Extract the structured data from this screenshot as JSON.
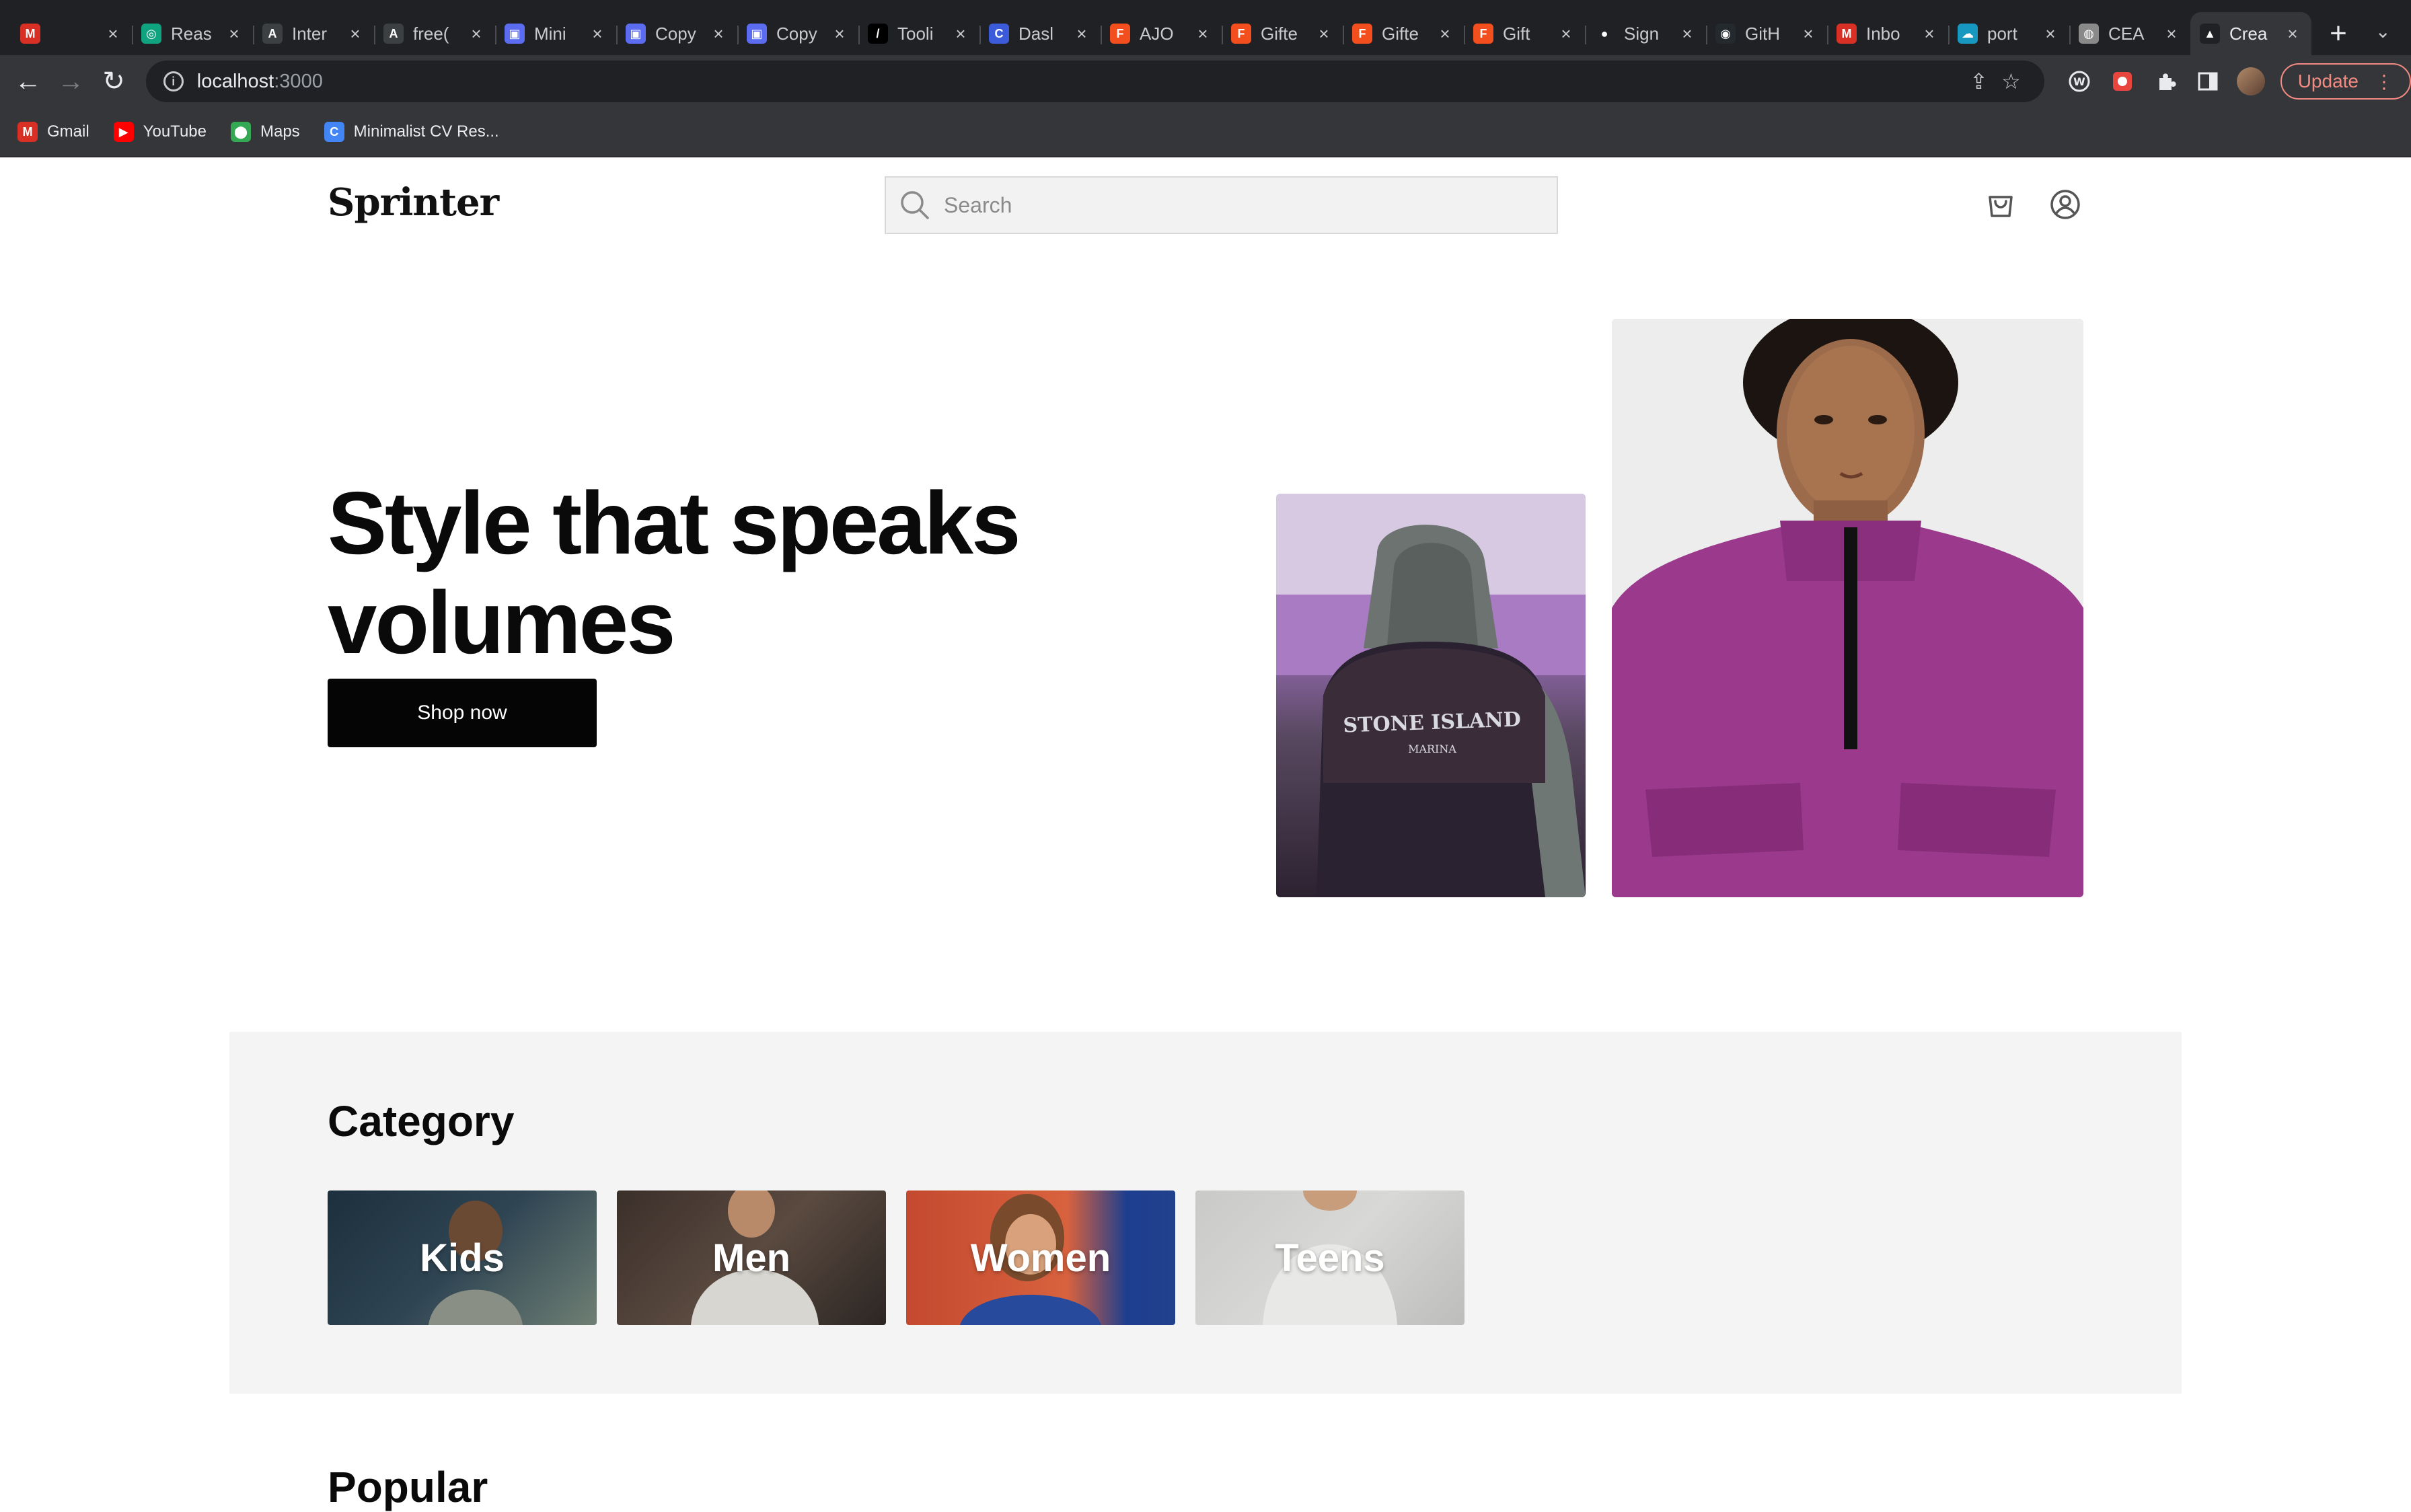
{
  "browser": {
    "tabs": [
      {
        "title": "",
        "favicon": "gmail-m-icon",
        "color": "#d93025",
        "glyph": "M"
      },
      {
        "title": "Reas",
        "favicon": "openai-icon",
        "color": "#10a37f",
        "glyph": "◎"
      },
      {
        "title": "Inter",
        "favicon": "angular-a-icon",
        "color": "#3c4043",
        "glyph": "A"
      },
      {
        "title": "free(",
        "favicon": "angular-a-icon",
        "color": "#3c4043",
        "glyph": "A"
      },
      {
        "title": "Mini",
        "favicon": "app-icon",
        "color": "#5b6cf0",
        "glyph": "▣"
      },
      {
        "title": "Copy",
        "favicon": "app-icon",
        "color": "#5b6cf0",
        "glyph": "▣"
      },
      {
        "title": "Copy",
        "favicon": "app-icon",
        "color": "#5b6cf0",
        "glyph": "▣"
      },
      {
        "title": "Tooli",
        "favicon": "slash-icon",
        "color": "#000000",
        "glyph": "/"
      },
      {
        "title": "Dasl",
        "favicon": "c-logo-icon",
        "color": "#3b5bdb",
        "glyph": "C"
      },
      {
        "title": "AJO",
        "favicon": "figma-icon",
        "color": "#f24e1e",
        "glyph": "F"
      },
      {
        "title": "Gifte",
        "favicon": "figma-icon",
        "color": "#f24e1e",
        "glyph": "F"
      },
      {
        "title": "Gifte",
        "favicon": "figma-icon",
        "color": "#f24e1e",
        "glyph": "F"
      },
      {
        "title": "Gift",
        "favicon": "figma-icon",
        "color": "#f24e1e",
        "glyph": "F"
      },
      {
        "title": "Sign",
        "favicon": "dot-icon",
        "color": "#202124",
        "glyph": "●"
      },
      {
        "title": "GitH",
        "favicon": "github-icon",
        "color": "#24292e",
        "glyph": "◉"
      },
      {
        "title": "Inbo",
        "favicon": "gmail-m-icon",
        "color": "#d93025",
        "glyph": "M"
      },
      {
        "title": "port",
        "favicon": "salesforce-cloud-icon",
        "color": "#1798c1",
        "glyph": "☁"
      },
      {
        "title": "CEA",
        "favicon": "seal-icon",
        "color": "#8a8a8a",
        "glyph": "◍"
      },
      {
        "title": "Crea",
        "favicon": "triangle-icon",
        "color": "#202124",
        "glyph": "▲",
        "active": true
      }
    ],
    "new_tab_glyph": "+",
    "tab_menu_glyph": "⌄",
    "url_host": "localhost",
    "url_port": ":3000",
    "update_label": "Update",
    "update_menu_glyph": "⋮",
    "bookmarks": [
      {
        "label": "Gmail",
        "icon": "gmail-icon",
        "color": "#d93025",
        "glyph": "M"
      },
      {
        "label": "YouTube",
        "icon": "youtube-icon",
        "color": "#ff0000",
        "glyph": "▶"
      },
      {
        "label": "Maps",
        "icon": "maps-pin-icon",
        "color": "#34a853",
        "glyph": "⬤"
      },
      {
        "label": "Minimalist CV Res...",
        "icon": "cv-icon",
        "color": "#4285f4",
        "glyph": "C"
      }
    ]
  },
  "site": {
    "logo": "Sprinter",
    "search_placeholder": "Search",
    "hero": {
      "title": "Style that speaks volumes",
      "cta": "Shop now",
      "jacket_print_line1": "STONE ISLAND",
      "jacket_print_line2": "MARINA"
    },
    "category": {
      "title": "Category",
      "items": [
        {
          "label": "Kids"
        },
        {
          "label": "Men"
        },
        {
          "label": "Women"
        },
        {
          "label": "Teens"
        }
      ]
    },
    "popular_title": "Popular"
  }
}
